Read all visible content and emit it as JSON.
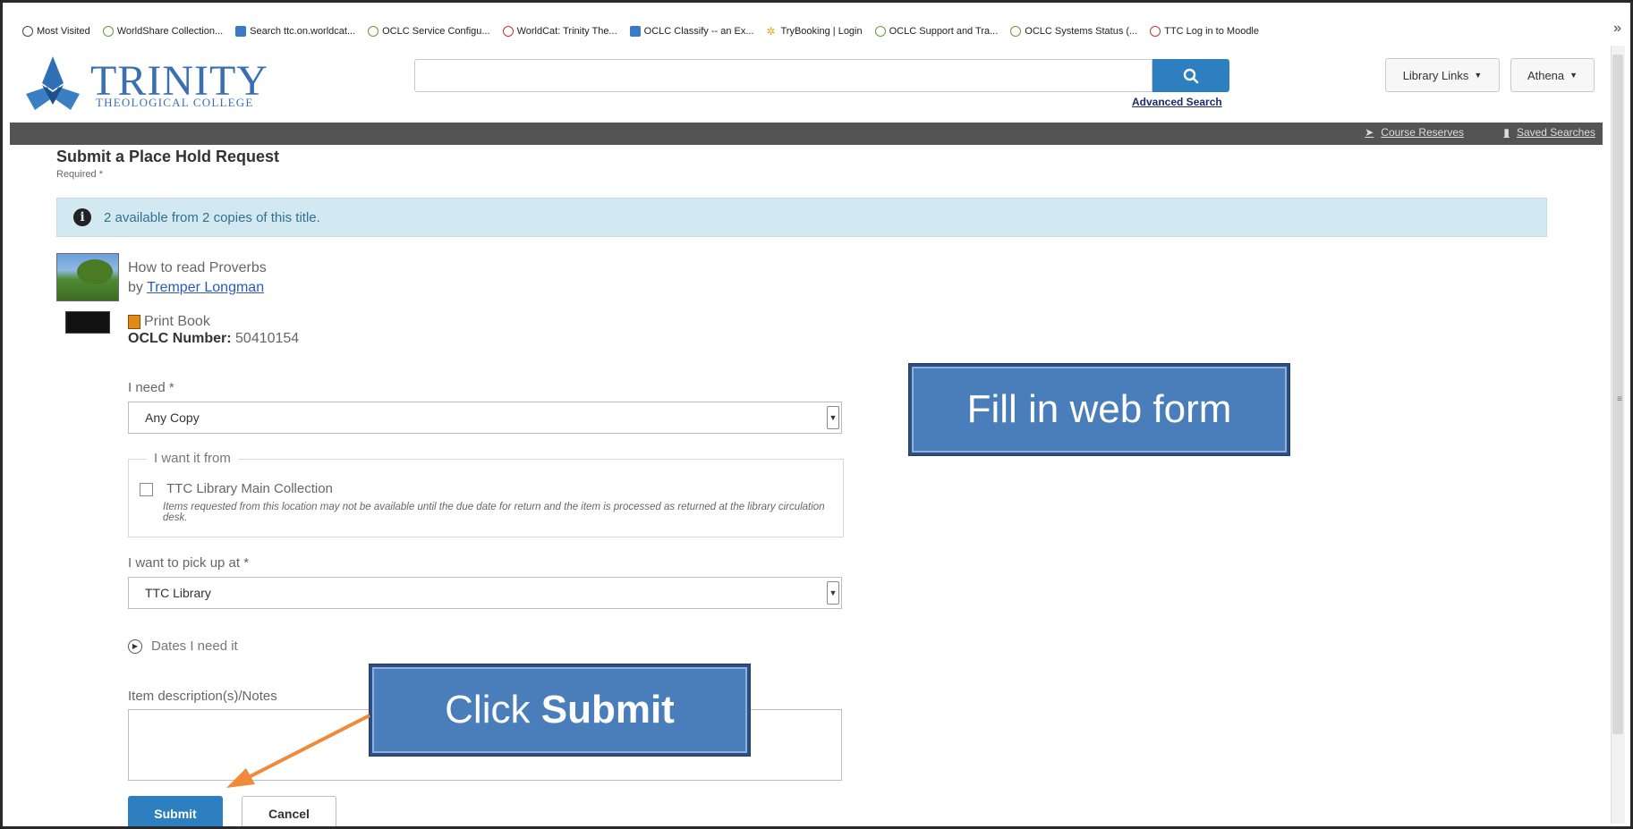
{
  "bookmarks": [
    {
      "label": "Most Visited",
      "icon": "gear-icon"
    },
    {
      "label": "WorldShare Collection...",
      "icon": "oclc-icon"
    },
    {
      "label": "Search ttc.on.worldcat...",
      "icon": "worldcat-icon"
    },
    {
      "label": "OCLC Service Configu...",
      "icon": "oclc-icon"
    },
    {
      "label": "WorldCat: Trinity The...",
      "icon": "worldcat-icon"
    },
    {
      "label": "OCLC Classify -- an Ex...",
      "icon": "classify-icon"
    },
    {
      "label": "TryBooking | Login",
      "icon": "star-icon"
    },
    {
      "label": "OCLC Support and Tra...",
      "icon": "oclc-icon"
    },
    {
      "label": "OCLC Systems Status (...",
      "icon": "oclc-icon"
    },
    {
      "label": "TTC Log in to Moodle",
      "icon": "moodle-icon"
    }
  ],
  "header": {
    "logo_name": "TRINITY",
    "logo_sub": "THEOLOGICAL COLLEGE",
    "search_placeholder": "",
    "advanced_search": "Advanced Search",
    "library_links": "Library Links",
    "user_menu": "Athena",
    "course_reserves": "Course Reserves",
    "saved_searches": "Saved Searches"
  },
  "form": {
    "title": "Submit a Place Hold Request",
    "required_note": "Required *",
    "availability": "2 available from 2 copies of this title.",
    "book_title": "How to read Proverbs",
    "by": "by",
    "author": "Tremper Longman",
    "format": "Print Book",
    "oclc_label": "OCLC Number:",
    "oclc_number": "50410154",
    "need_label": "I need *",
    "need_value": "Any Copy",
    "want_from_legend": "I want it from",
    "location_label": "TTC Library Main Collection",
    "location_note": "Items requested from this location may not be available until the due date for return and the item is processed as returned at the library circulation desk.",
    "pickup_label": "I want to pick up at *",
    "pickup_value": "TTC Library",
    "dates_label": "Dates I need it",
    "notes_label": "Item description(s)/Notes",
    "notes_value": "",
    "submit": "Submit",
    "cancel": "Cancel"
  },
  "annotations": {
    "fill_in": "Fill in web form",
    "click_prefix": "Click",
    "click_bold": "Submit"
  },
  "colors": {
    "primary_button": "#2e7fc0",
    "alert_bg": "#d2e9f1",
    "callout_bg": "#4a7ebb",
    "arrow": "#f08a3a"
  }
}
